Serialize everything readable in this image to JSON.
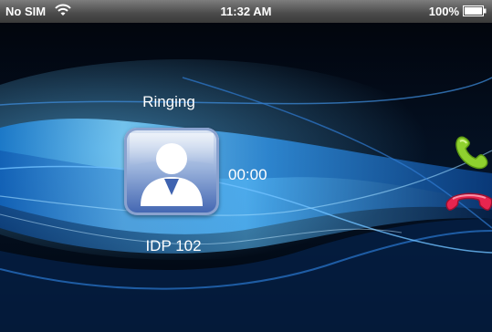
{
  "status_bar": {
    "carrier": "No SIM",
    "time": "11:32 AM",
    "battery": "100%",
    "wifi_icon": "wifi-icon",
    "battery_icon": "battery-icon"
  },
  "call": {
    "status": "Ringing",
    "timer": "00:00",
    "contact_name": "IDP 102",
    "avatar_icon": "person-icon",
    "answer_icon": "phone-green-icon",
    "decline_icon": "phone-red-icon"
  },
  "colors": {
    "answer": "#8fd12f",
    "decline": "#e8254f",
    "wave": "#4fb3ff"
  }
}
